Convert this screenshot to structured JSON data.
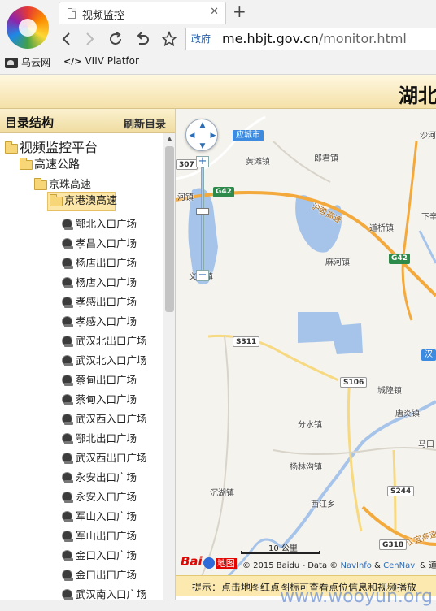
{
  "browser": {
    "tab_title": "视频监控",
    "tab_close": "✕",
    "new_tab": "+",
    "address_badge": "政府",
    "url_host": "me.hbjt.gov.cn",
    "url_path": "/monitor.html",
    "bookmarks": [
      {
        "label": "乌云网",
        "icon": "wuyun-icon"
      },
      {
        "label": "VIIV Platfor",
        "icon": "code-icon"
      }
    ]
  },
  "header": {
    "title": "湖北"
  },
  "sidebar": {
    "title": "目录结构",
    "refresh_label": "刷新目录",
    "tree": {
      "root": "视频监控平台",
      "highway": "高速公路",
      "jingzhu": "京珠高速",
      "jinggang": "京港澳高速"
    },
    "cameras": [
      "鄂北入口广场",
      "孝昌入口广场",
      "杨店出口广场",
      "杨店入口广场",
      "孝感出口广场",
      "孝感入口广场",
      "武汉北出口广场",
      "武汉北入口广场",
      "蔡甸出口广场",
      "蔡甸入口广场",
      "武汉西入口广场",
      "鄂北出口广场",
      "武汉西出口广场",
      "永安出口广场",
      "永安入口广场",
      "军山入口广场",
      "军山出口广场",
      "金口入口广场",
      "金口出口广场",
      "武汉南入口广场"
    ]
  },
  "map": {
    "city_labels": [
      {
        "text": "应城市",
        "kind": "city"
      },
      {
        "text": "汉",
        "kind": "city"
      }
    ],
    "place_labels": [
      "黄滩镇",
      "郎君镇",
      "沙河",
      "河镇",
      "道桥镇",
      "下辛",
      "麻河镇",
      "义河镇",
      "城隍镇",
      "唐炎镇",
      "分水镇",
      "马口",
      "杨林沟镇",
      "沉湖镇",
      "西江乡",
      "沪蓉高速",
      "汉宜高速"
    ],
    "road_shields": [
      "G42",
      "G42",
      "S311",
      "S106",
      "S244",
      "G318",
      "307"
    ],
    "zoom_in": "+",
    "zoom_out": "−",
    "scale_label": "10 公里",
    "baidu_logo": "Bai",
    "baidu_logo_tail": "地图",
    "copyright_prefix": "© 2015 Baidu - Data ©",
    "copyright_link1": "NavInfo",
    "copyright_mid": "&",
    "copyright_link2": "CenNavi",
    "copyright_tail": "& 道道",
    "hint": "提示：点击地图红点图标可查看点位信息和视频播放"
  },
  "watermark": "www.wooyun.org",
  "colors": {
    "header_gradient_top": "#fff8e0",
    "header_gradient_bottom": "#f4e0a8",
    "tree_selected": "#fde7a8",
    "map_water": "#a6c4ea",
    "expressway": "#f3a93c",
    "link": "#2c6db5"
  }
}
